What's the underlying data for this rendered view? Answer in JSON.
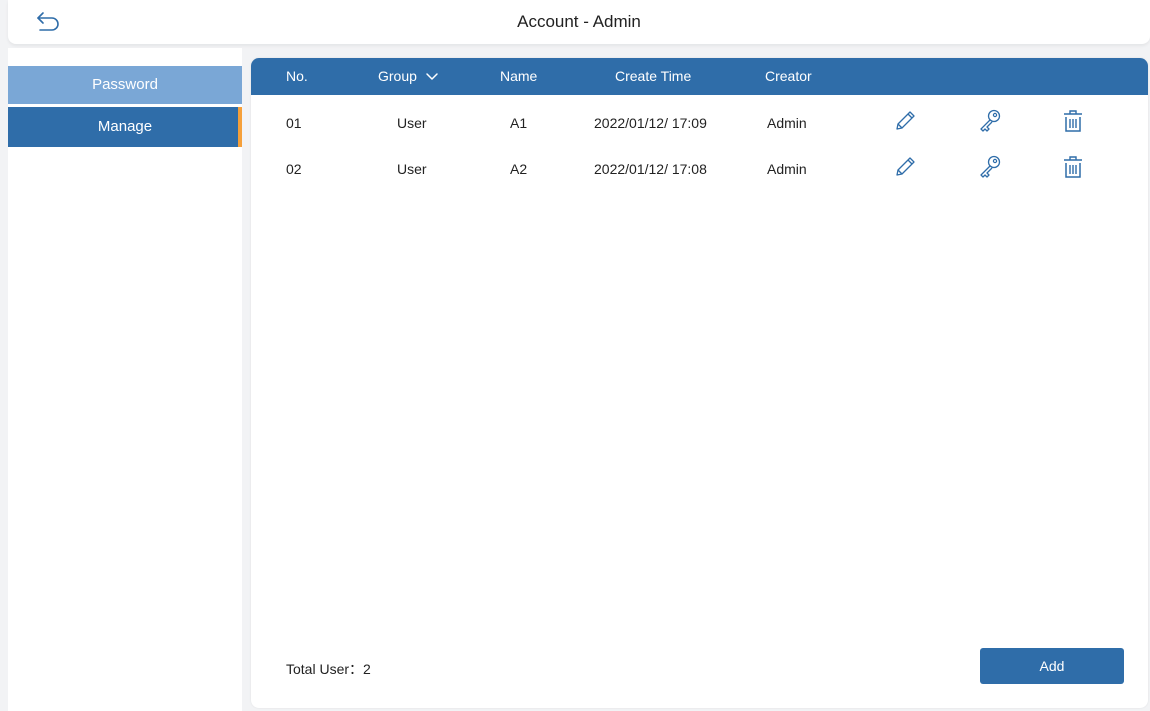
{
  "header": {
    "title": "Account - Admin",
    "back_icon": "back-arrow-icon"
  },
  "sidebar": {
    "items": [
      {
        "label": "Password",
        "active": false
      },
      {
        "label": "Manage",
        "active": true
      }
    ]
  },
  "table": {
    "columns": {
      "no": "No.",
      "group": "Group",
      "name": "Name",
      "create_time": "Create Time",
      "creator": "Creator"
    },
    "group_dropdown_icon": "chevron-down-icon",
    "rows": [
      {
        "no": "01",
        "group": "User",
        "name": "A1",
        "create_time": "2022/01/12/ 17:09",
        "creator": "Admin"
      },
      {
        "no": "02",
        "group": "User",
        "name": "A2",
        "create_time": "2022/01/12/ 17:08",
        "creator": "Admin"
      }
    ],
    "row_actions": [
      "edit-pencil-icon",
      "key-icon",
      "trash-icon"
    ]
  },
  "footer": {
    "total_label": "Total User：2",
    "add_label": "Add"
  },
  "colors": {
    "primary": "#2f6da9",
    "primary_light": "#7aa7d6",
    "accent": "#f5a03a",
    "background": "#f2f3f5"
  }
}
